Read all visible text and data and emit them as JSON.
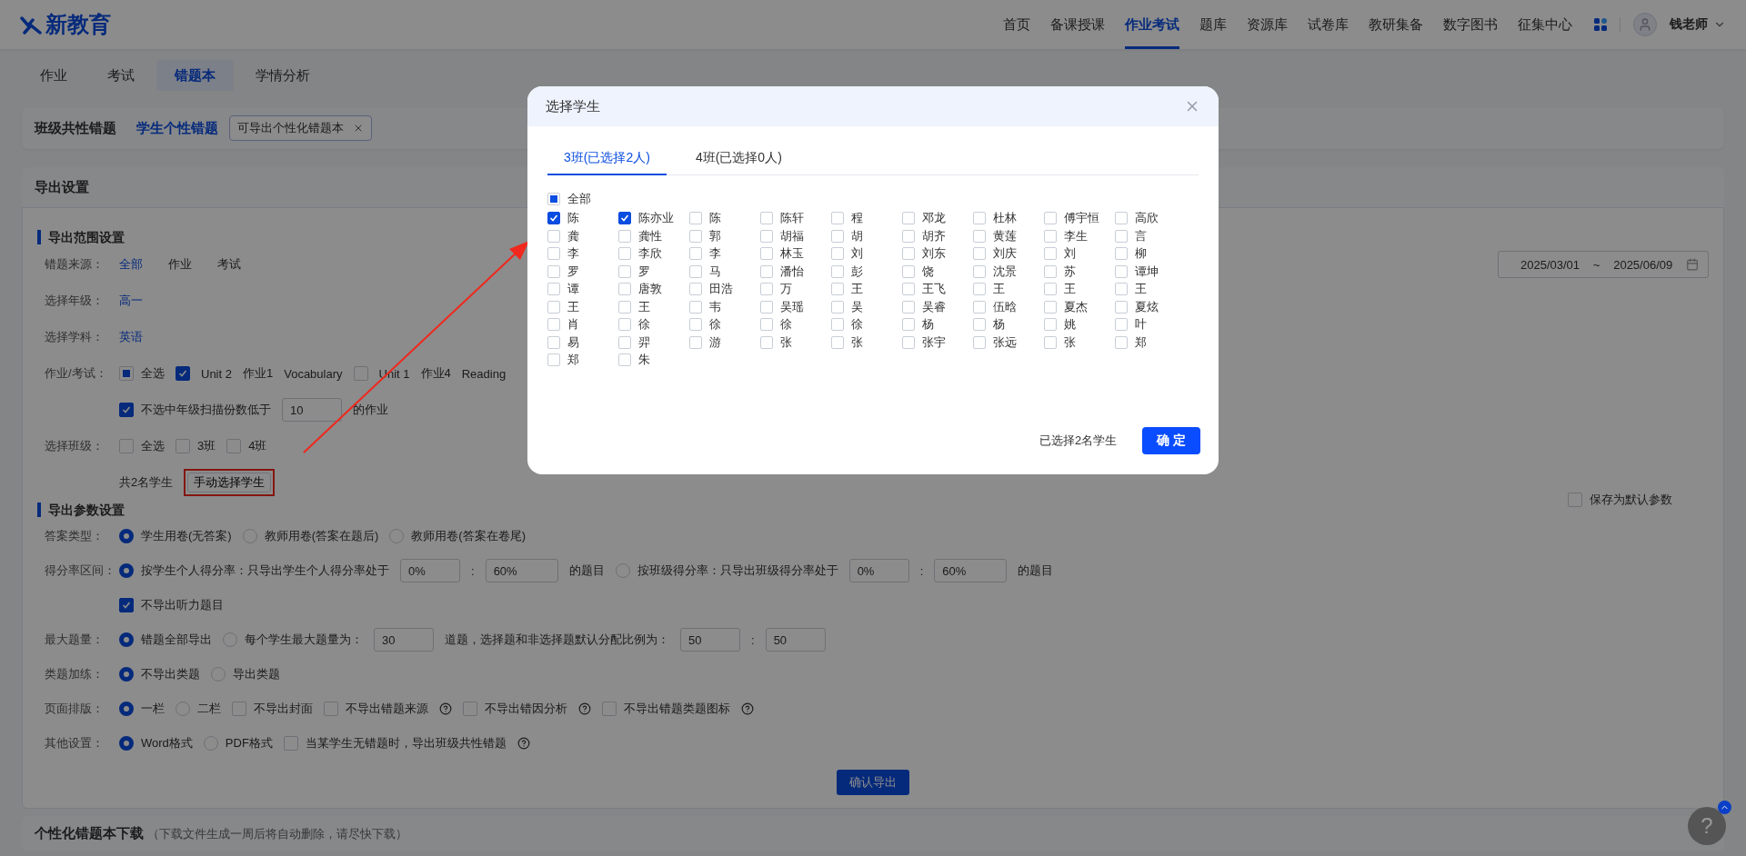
{
  "header": {
    "logo": "新教育",
    "nav": [
      {
        "label": "首页",
        "selected": false
      },
      {
        "label": "备课授课",
        "selected": false
      },
      {
        "label": "作业考试",
        "selected": true
      },
      {
        "label": "题库",
        "selected": false
      },
      {
        "label": "资源库",
        "selected": false
      },
      {
        "label": "试卷库",
        "selected": false
      },
      {
        "label": "教研集备",
        "selected": false
      },
      {
        "label": "数字图书",
        "selected": false
      },
      {
        "label": "征集中心",
        "selected": false
      }
    ],
    "user": "钱老师"
  },
  "subtabs": [
    {
      "label": "作业",
      "selected": false
    },
    {
      "label": "考试",
      "selected": false
    },
    {
      "label": "错题本",
      "selected": true
    },
    {
      "label": "学情分析",
      "selected": false
    }
  ],
  "mode_bar": {
    "items": [
      {
        "label": "班级共性错题",
        "selected": false
      },
      {
        "label": "学生个性错题",
        "selected": true
      }
    ],
    "tag": "可导出个性化错题本"
  },
  "export": {
    "title": "导出设置",
    "range": {
      "title": "导出范围设置",
      "rows": [
        {
          "label": "错题来源：",
          "items": [
            {
              "kind": "link",
              "label": "全部",
              "selected": true
            },
            {
              "kind": "link",
              "label": "作业",
              "selected": false
            },
            {
              "kind": "link",
              "label": "考试",
              "selected": false
            },
            {
              "kind": "date_range",
              "start": "2025/03/01",
              "separator": "~",
              "end": "2025/06/09"
            }
          ]
        },
        {
          "label": "选择年级：",
          "items": [
            {
              "kind": "link",
              "label": "高一",
              "selected": true
            }
          ]
        },
        {
          "label": "选择学科：",
          "items": [
            {
              "kind": "link",
              "label": "英语",
              "selected": true
            }
          ]
        },
        {
          "label": "作业/考试：",
          "items": [
            {
              "kind": "checkbox",
              "label": "全选",
              "checked": false,
              "indeterminate": true
            },
            {
              "kind": "checkbox",
              "checked": true
            },
            {
              "kind": "text",
              "text": "Unit 2"
            },
            {
              "kind": "text",
              "text": "作业1"
            },
            {
              "kind": "text",
              "text": "Vocabulary"
            },
            {
              "kind": "checkbox",
              "checked": false
            },
            {
              "kind": "text",
              "text": "Unit 1"
            },
            {
              "kind": "text",
              "text": "作业4"
            },
            {
              "kind": "text",
              "text": "Reading"
            }
          ]
        },
        {
          "items": [
            {
              "kind": "checkbox",
              "label": "不选中年级扫描份数低于",
              "checked": true
            },
            {
              "kind": "input",
              "value": "10"
            },
            {
              "kind": "text",
              "text": "的作业"
            }
          ]
        },
        {
          "label": "选择班级：",
          "items": [
            {
              "kind": "checkbox",
              "label": "全选",
              "checked": false
            },
            {
              "kind": "checkbox",
              "label": "3班",
              "checked": false
            },
            {
              "kind": "checkbox",
              "label": "4班",
              "checked": false
            }
          ]
        },
        {
          "items": [
            {
              "kind": "text",
              "text": "共2名学生"
            },
            {
              "kind": "button",
              "label": "手动选择学生",
              "highlighted": true
            }
          ]
        }
      ]
    },
    "params": {
      "title": "导出参数设置",
      "save_default": {
        "label": "保存为默认参数",
        "checked": false
      },
      "rows": [
        {
          "label": "答案类型：",
          "items": [
            {
              "kind": "radio",
              "label": "学生用卷(无答案)",
              "selected": true
            },
            {
              "kind": "radio",
              "label": "教师用卷(答案在题后)",
              "selected": false
            },
            {
              "kind": "radio",
              "label": "教师用卷(答案在卷尾)",
              "selected": false
            }
          ]
        },
        {
          "label": "得分率区间：",
          "items": [
            {
              "kind": "radio",
              "label": "按学生个人得分率：只导出学生个人得分率处于",
              "selected": true
            },
            {
              "kind": "input",
              "value": "0%"
            },
            {
              "kind": "text",
              "text": ":"
            },
            {
              "kind": "input",
              "value": "60%"
            },
            {
              "kind": "text",
              "text": "的题目"
            },
            {
              "kind": "radio",
              "label": "按班级得分率：只导出班级得分率处于",
              "selected": false
            },
            {
              "kind": "input",
              "value": "0%"
            },
            {
              "kind": "text",
              "text": ":"
            },
            {
              "kind": "input",
              "value": "60%"
            },
            {
              "kind": "text",
              "text": "的题目"
            }
          ]
        },
        {
          "items": [
            {
              "kind": "checkbox",
              "label": "不导出听力题目",
              "checked": true
            }
          ]
        },
        {
          "label": "最大题量：",
          "items": [
            {
              "kind": "radio",
              "label": "错题全部导出",
              "selected": true
            },
            {
              "kind": "radio",
              "label": "每个学生最大题量为：",
              "selected": false
            },
            {
              "kind": "input",
              "value": "30"
            },
            {
              "kind": "text",
              "text": "道题，选择题和非选择题默认分配比例为："
            },
            {
              "kind": "input",
              "value": "50"
            },
            {
              "kind": "text",
              "text": ":"
            },
            {
              "kind": "input",
              "value": "50"
            }
          ]
        },
        {
          "label": "类题加练：",
          "items": [
            {
              "kind": "radio",
              "label": "不导出类题",
              "selected": true
            },
            {
              "kind": "radio",
              "label": "导出类题",
              "selected": false
            }
          ]
        },
        {
          "label": "页面排版：",
          "items": [
            {
              "kind": "radio",
              "label": "一栏",
              "selected": true
            },
            {
              "kind": "radio",
              "label": "二栏",
              "selected": false
            },
            {
              "kind": "checkbox",
              "label": "不导出封面",
              "checked": false
            },
            {
              "kind": "checkbox",
              "label": "不导出错题来源",
              "checked": false
            },
            {
              "kind": "help"
            },
            {
              "kind": "checkbox",
              "label": "不导出错因分析",
              "checked": false
            },
            {
              "kind": "help"
            },
            {
              "kind": "checkbox",
              "label": "不导出错题类题图标",
              "checked": false
            },
            {
              "kind": "help"
            }
          ]
        },
        {
          "label": "其他设置：",
          "items": [
            {
              "kind": "radio",
              "label": "Word格式",
              "selected": true
            },
            {
              "kind": "radio",
              "label": "PDF格式",
              "selected": false
            },
            {
              "kind": "checkbox",
              "label": "当某学生无错题时，导出班级共性错题",
              "checked": false
            },
            {
              "kind": "help"
            }
          ]
        }
      ]
    },
    "submit": "确认导出"
  },
  "download": {
    "title": "个性化错题本下载",
    "note": "（下载文件生成一周后将自动删除，请尽快下载）"
  },
  "modal": {
    "title": "选择学生",
    "tabs": [
      {
        "label": "3班(已选择2人)",
        "selected": true
      },
      {
        "label": "4班(已选择0人)",
        "selected": false
      }
    ],
    "select_all": {
      "label": "全部",
      "checked": false,
      "indeterminate": true
    },
    "students": [
      {
        "name": "陈",
        "selected": true
      },
      {
        "name": "陈亦业",
        "selected": true
      },
      {
        "name": "陈",
        "selected": false
      },
      {
        "name": "陈轩",
        "selected": false
      },
      {
        "name": "程",
        "selected": false
      },
      {
        "name": "邓龙",
        "selected": false
      },
      {
        "name": "杜林",
        "selected": false
      },
      {
        "name": "傅宇恒",
        "selected": false
      },
      {
        "name": "高欣",
        "selected": false
      },
      {
        "name": "龚",
        "selected": false
      },
      {
        "name": "龚性",
        "selected": false
      },
      {
        "name": "郭",
        "selected": false
      },
      {
        "name": "胡福",
        "selected": false
      },
      {
        "name": "胡",
        "selected": false
      },
      {
        "name": "胡齐",
        "selected": false
      },
      {
        "name": "黄莲",
        "selected": false
      },
      {
        "name": "李生",
        "selected": false
      },
      {
        "name": "言",
        "selected": false
      },
      {
        "name": "李",
        "selected": false
      },
      {
        "name": "李欣",
        "selected": false
      },
      {
        "name": "李",
        "selected": false
      },
      {
        "name": "林玉",
        "selected": false
      },
      {
        "name": "刘",
        "selected": false
      },
      {
        "name": "刘东",
        "selected": false
      },
      {
        "name": "刘庆",
        "selected": false
      },
      {
        "name": "刘",
        "selected": false
      },
      {
        "name": "柳",
        "selected": false
      },
      {
        "name": "罗",
        "selected": false
      },
      {
        "name": "罗",
        "selected": false
      },
      {
        "name": "马",
        "selected": false
      },
      {
        "name": "潘怡",
        "selected": false
      },
      {
        "name": "彭",
        "selected": false
      },
      {
        "name": "饶",
        "selected": false
      },
      {
        "name": "沈景",
        "selected": false
      },
      {
        "name": "苏",
        "selected": false
      },
      {
        "name": "谭坤",
        "selected": false
      },
      {
        "name": "谭",
        "selected": false
      },
      {
        "name": "唐敦",
        "selected": false
      },
      {
        "name": "田浩",
        "selected": false
      },
      {
        "name": "万",
        "selected": false
      },
      {
        "name": "王",
        "selected": false
      },
      {
        "name": "王飞",
        "selected": false
      },
      {
        "name": "王",
        "selected": false
      },
      {
        "name": "王",
        "selected": false
      },
      {
        "name": "王",
        "selected": false
      },
      {
        "name": "王",
        "selected": false
      },
      {
        "name": "王",
        "selected": false
      },
      {
        "name": "韦",
        "selected": false
      },
      {
        "name": "吴瑶",
        "selected": false
      },
      {
        "name": "吴",
        "selected": false
      },
      {
        "name": "吴睿",
        "selected": false
      },
      {
        "name": "伍晗",
        "selected": false
      },
      {
        "name": "夏杰",
        "selected": false
      },
      {
        "name": "夏炫",
        "selected": false
      },
      {
        "name": "肖",
        "selected": false
      },
      {
        "name": "徐",
        "selected": false
      },
      {
        "name": "徐",
        "selected": false
      },
      {
        "name": "徐",
        "selected": false
      },
      {
        "name": "徐",
        "selected": false
      },
      {
        "name": "杨",
        "selected": false
      },
      {
        "name": "杨",
        "selected": false
      },
      {
        "name": "姚",
        "selected": false
      },
      {
        "name": "叶",
        "selected": false
      },
      {
        "name": "易",
        "selected": false
      },
      {
        "name": "羿",
        "selected": false
      },
      {
        "name": "游",
        "selected": false
      },
      {
        "name": "张",
        "selected": false
      },
      {
        "name": "张",
        "selected": false
      },
      {
        "name": "张宇",
        "selected": false
      },
      {
        "name": "张远",
        "selected": false
      },
      {
        "name": "张",
        "selected": false
      },
      {
        "name": "郑",
        "selected": false
      },
      {
        "name": "郑",
        "selected": false
      },
      {
        "name": "朱",
        "selected": false
      }
    ],
    "summary": "已选择2名学生",
    "confirm": "确 定"
  },
  "help_button": "?"
}
